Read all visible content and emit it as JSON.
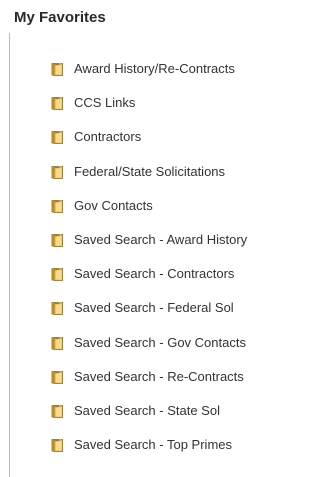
{
  "panel": {
    "title": "My Favorites"
  },
  "favorites": {
    "items": [
      {
        "label": "Award History/Re-Contracts",
        "icon": "folder-icon"
      },
      {
        "label": "CCS Links",
        "icon": "folder-icon"
      },
      {
        "label": "Contractors",
        "icon": "folder-icon"
      },
      {
        "label": "Federal/State Solicitations",
        "icon": "folder-icon"
      },
      {
        "label": "Gov Contacts",
        "icon": "folder-icon"
      },
      {
        "label": "Saved Search - Award History",
        "icon": "folder-icon"
      },
      {
        "label": "Saved Search - Contractors",
        "icon": "folder-icon"
      },
      {
        "label": "Saved Search - Federal Sol",
        "icon": "folder-icon"
      },
      {
        "label": "Saved Search - Gov Contacts",
        "icon": "folder-icon"
      },
      {
        "label": "Saved Search - Re-Contracts",
        "icon": "folder-icon"
      },
      {
        "label": "Saved Search - State Sol",
        "icon": "folder-icon"
      },
      {
        "label": "Saved Search - Top Primes",
        "icon": "folder-icon"
      }
    ]
  },
  "colors": {
    "folder_front": "#f2c14e",
    "folder_back": "#d9a42f",
    "folder_outline": "#8a6a1c",
    "text": "#333333",
    "title": "#2b2b2b",
    "border": "#b8b8b8"
  }
}
